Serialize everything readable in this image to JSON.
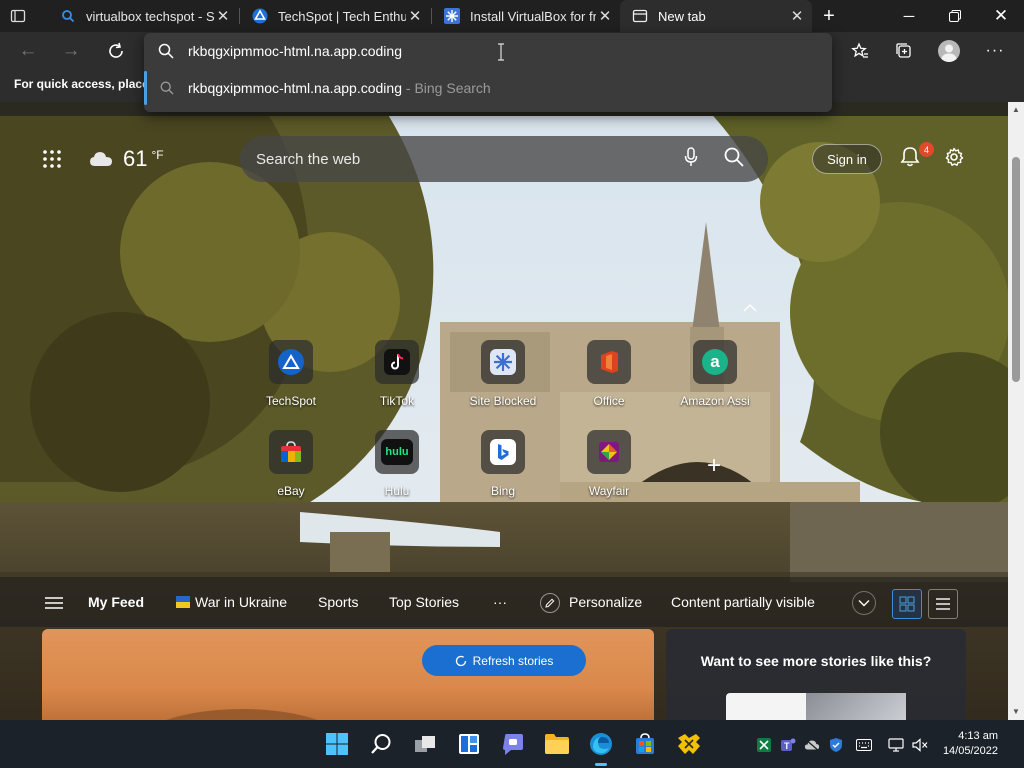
{
  "browser": {
    "tabs": [
      {
        "title": "virtualbox techspot - Se",
        "favicon": "search-icon",
        "active": false
      },
      {
        "title": "TechSpot | Tech Enthusi",
        "favicon": "techspot-icon",
        "active": false
      },
      {
        "title": "Install VirtualBox for fre",
        "favicon": "virtualbox-icon",
        "active": false
      },
      {
        "title": "New tab",
        "favicon": "newtab-icon",
        "active": true
      }
    ],
    "address_value": "rkbqgxipmmoc-html.na.app.coding",
    "suggestion": {
      "text": "rkbqgxipmmoc-html.na.app.coding",
      "suffix": " - Bing Search"
    },
    "favorites_bar_hint": "For quick access, place y"
  },
  "ntp": {
    "weather": {
      "temp": "61",
      "unit": "°F",
      "icon": "cloud-icon"
    },
    "search_placeholder": "Search the web",
    "sign_in": "Sign in",
    "notification_count": "4",
    "quick_links": [
      {
        "label": "TechSpot",
        "icon": "techspot-icon",
        "color": "#1463c8"
      },
      {
        "label": "TikTok",
        "icon": "tiktok-icon",
        "color": "#111111"
      },
      {
        "label": "Site Blocked",
        "icon": "site-blocked-icon",
        "color": "#3b6fd6"
      },
      {
        "label": "Office",
        "icon": "office-icon",
        "color": "#e0411f"
      },
      {
        "label": "Amazon Assi",
        "icon": "amazon-assistant-icon",
        "color": "#1bb38a"
      },
      {
        "label": "eBay",
        "icon": "ebay-icon",
        "color": "#e53238"
      },
      {
        "label": "Hulu",
        "icon": "hulu-icon",
        "color": "#1ce783"
      },
      {
        "label": "Bing",
        "icon": "bing-icon",
        "color": "#ffffff"
      },
      {
        "label": "Wayfair",
        "icon": "wayfair-icon",
        "color": "#7f187f"
      }
    ],
    "feed": {
      "my_feed": "My Feed",
      "items": [
        "War in Ukraine",
        "Sports",
        "Top Stories"
      ],
      "more": "···",
      "personalize": "Personalize",
      "content_visibility": "Content partially visible"
    },
    "refresh_stories": "Refresh stories",
    "more_stories_prompt": "Want to see more stories like this?"
  },
  "taskbar": {
    "time": "4:13 am",
    "date": "14/05/2022"
  }
}
